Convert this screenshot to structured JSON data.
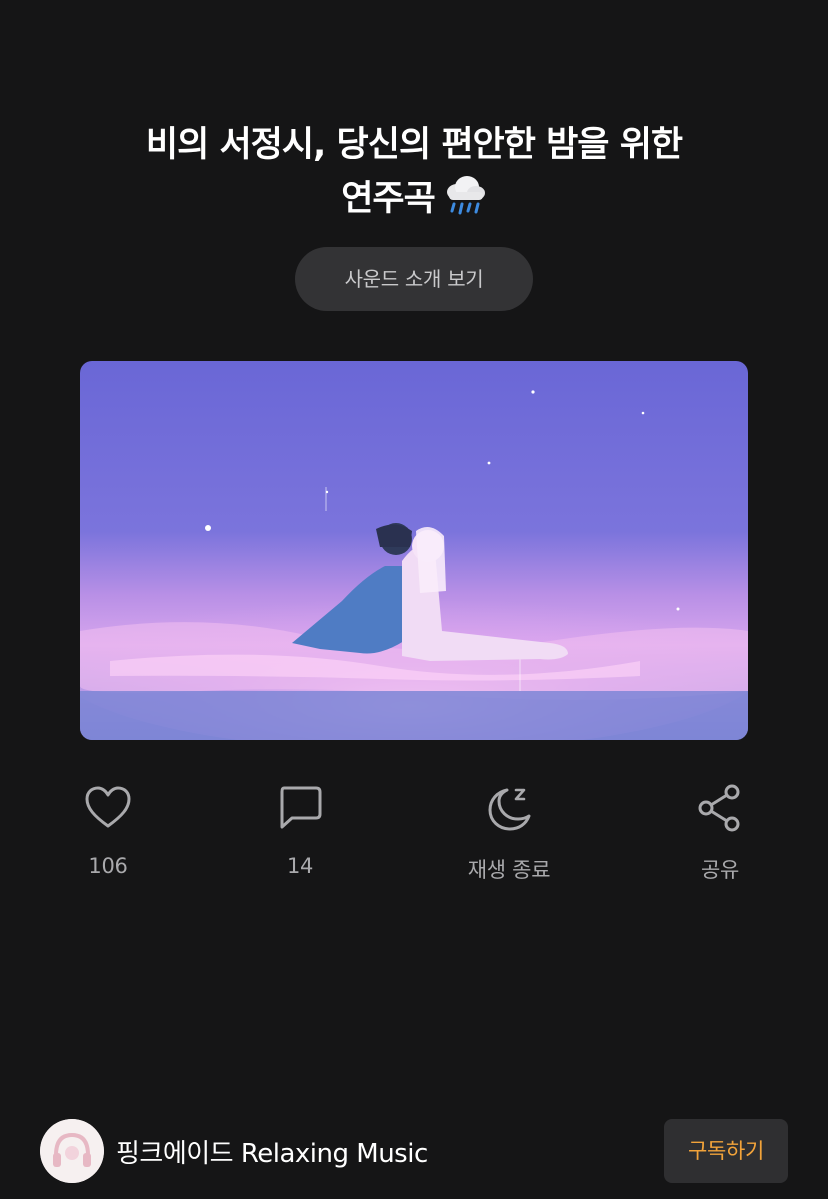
{
  "title": {
    "line1": "비의 서정시, 당신의 편안한 밤을 위한",
    "line2": "연주곡"
  },
  "intro_button": "사운드 소개 보기",
  "thumbnail": {
    "icon": "rain-cloud-emoji"
  },
  "actions": {
    "like_count": "106",
    "comment_count": "14",
    "sleep_timer_label": "재생 종료",
    "share_label": "공유"
  },
  "channel": {
    "name": "핑크에이드 Relaxing Music",
    "subscribe_label": "구독하기"
  },
  "colors": {
    "background": "#151516",
    "accent": "#f2a33a",
    "icon": "#a9a9ac"
  }
}
